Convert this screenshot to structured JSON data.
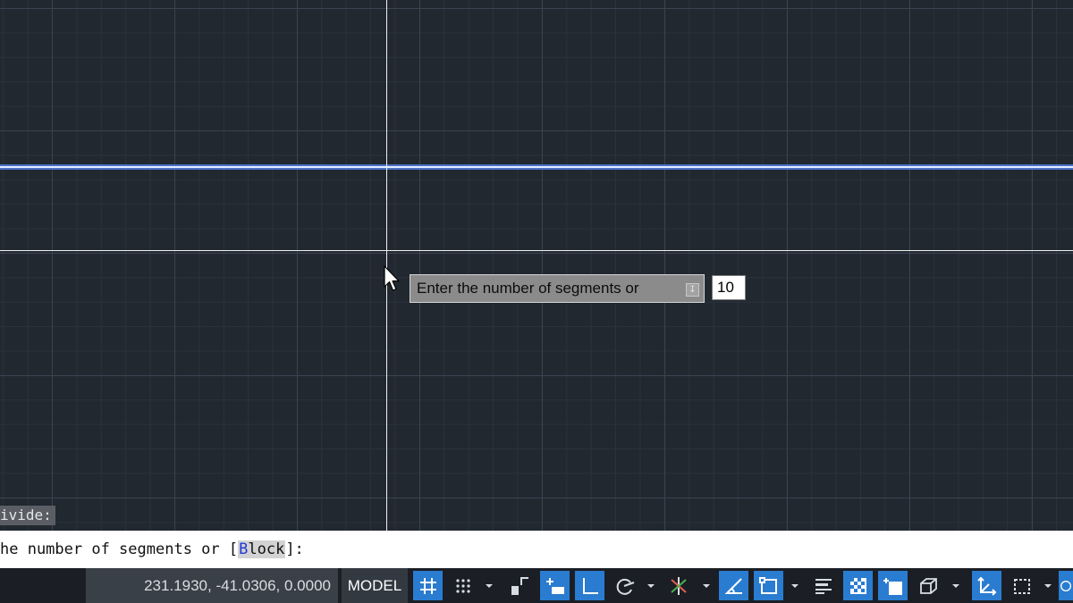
{
  "canvas": {
    "grid": "on",
    "colors": {
      "background": "#212830",
      "selected_line": "#4c72c8",
      "crosshair": "#f0f0f0"
    }
  },
  "dynamic_input": {
    "prompt": "Enter the number of segments or",
    "value": "10"
  },
  "command_history": {
    "text": "ivide:"
  },
  "command_line": {
    "prefix": "he number of segments or [",
    "keyword_first_letter": "B",
    "keyword_rest": "lock",
    "suffix": "]:"
  },
  "status_bar": {
    "coordinates": "231.1930, -41.0306, 0.0000",
    "model_label": "MODEL",
    "buttons": [
      {
        "name": "grid-display",
        "state": "on"
      },
      {
        "name": "snap-mode",
        "state": "off"
      },
      {
        "name": "infer-constraints",
        "state": "off"
      },
      {
        "name": "dynamic-input",
        "state": "on"
      },
      {
        "name": "ortho-mode",
        "state": "on"
      },
      {
        "name": "polar-tracking",
        "state": "off"
      },
      {
        "name": "isometric-drafting",
        "state": "off"
      },
      {
        "name": "object-snap-tracking",
        "state": "on"
      },
      {
        "name": "object-snap",
        "state": "on"
      },
      {
        "name": "lineweight",
        "state": "off"
      },
      {
        "name": "transparency",
        "state": "on"
      },
      {
        "name": "selection-cycling",
        "state": "on"
      },
      {
        "name": "3d-object-snap",
        "state": "off"
      },
      {
        "name": "dynamic-ucs",
        "state": "on"
      },
      {
        "name": "selection-filtering",
        "state": "off"
      }
    ]
  }
}
